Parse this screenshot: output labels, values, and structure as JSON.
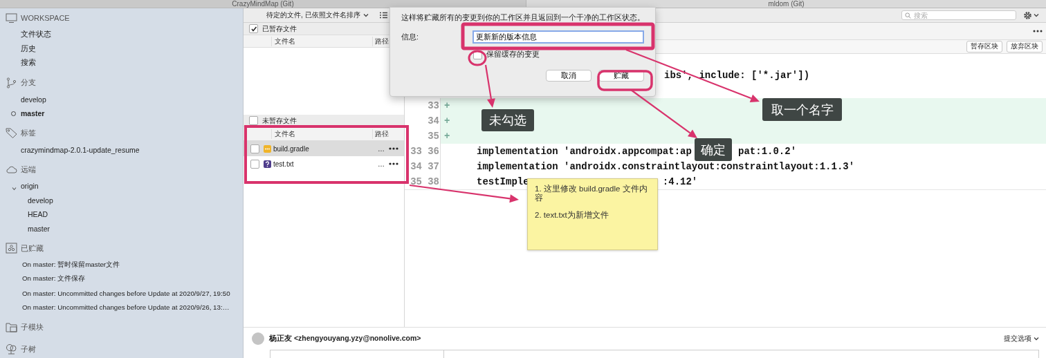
{
  "window_tabs": [
    {
      "title": "CrazyMindMap (Git)",
      "selected": true
    },
    {
      "title": "mldom (Git)",
      "selected": false
    }
  ],
  "sidebar": [
    {
      "kind": "workspace",
      "title": "WORKSPACE",
      "items": [
        {
          "label": "文件状态"
        },
        {
          "label": "历史"
        },
        {
          "label": "搜索"
        }
      ]
    },
    {
      "kind": "branches",
      "title": "分支",
      "items": [
        {
          "label": "develop",
          "current": false
        },
        {
          "label": "master",
          "current": true
        }
      ]
    },
    {
      "kind": "tags",
      "title": "标签",
      "items": [
        {
          "label": "crazymindmap-2.0.1-update_resume"
        }
      ]
    },
    {
      "kind": "remotes",
      "title": "远端",
      "items": [
        {
          "label": "origin",
          "expanded": true,
          "children": [
            {
              "label": "develop"
            },
            {
              "label": "HEAD"
            },
            {
              "label": "master"
            }
          ]
        }
      ]
    },
    {
      "kind": "stashes",
      "title": "已贮藏",
      "items": [
        {
          "label": "On master: 暂时保留master文件"
        },
        {
          "label": "On master: 文件保存"
        },
        {
          "label": "On master: Uncommitted changes before Update at 2020/9/27, 19:50"
        },
        {
          "label": "On master: Uncommitted changes before Update at 2020/9/26, 13:…"
        }
      ]
    },
    {
      "kind": "submodules",
      "title": "子模块"
    },
    {
      "kind": "subtrees",
      "title": "子树"
    }
  ],
  "toolbar": {
    "sort_menu": "待定的文件, 已依照文件名排序",
    "search_placeholder": "搜索"
  },
  "staged": {
    "title": "已暂存文件",
    "checked": true,
    "columns": [
      "文件名",
      "路径"
    ]
  },
  "unstaged": {
    "title": "未暂存文件",
    "checked": false,
    "columns": [
      "文件名",
      "路径"
    ],
    "files": [
      {
        "name": "build.gradle",
        "kind": "modified",
        "path": "…",
        "checked": false,
        "selected": true
      },
      {
        "name": "test.txt",
        "kind": "untracked",
        "path": "…",
        "checked": false,
        "selected": false
      }
    ]
  },
  "diff": {
    "hunk_buttons": [
      "暂存区块",
      "放弃区块"
    ],
    "lines": [
      {
        "kind": "partial",
        "code": "ibs', include: ['*.jar'])"
      },
      {
        "kind": "added",
        "new": "33",
        "marker": "+"
      },
      {
        "kind": "added",
        "new": "34",
        "marker": "+"
      },
      {
        "kind": "added",
        "new": "35",
        "marker": "+"
      },
      {
        "kind": "context",
        "old": "33",
        "new": "36",
        "code": "implementation 'androidx.appcompat:ap",
        "tail": "pat:1.0.2'"
      },
      {
        "kind": "context",
        "old": "34",
        "new": "37",
        "code": "implementation 'androidx.constraintlayout:constraintlayout:1.1.3'"
      },
      {
        "kind": "context",
        "old": "35",
        "new": "38",
        "code": "testImple",
        "tail": ":4.12'"
      }
    ]
  },
  "dialog": {
    "message": "这样将贮藏所有的变更到你的工作区并且返回到一个干净的工作区状态。",
    "field_label": "信息:",
    "field_value": "更新新的版本信息",
    "keep_staged": {
      "label": "保留缓存的变更",
      "checked": false
    },
    "buttons": [
      "取消",
      "贮藏"
    ]
  },
  "commit": {
    "author": "杨正友 <zhengyouyang.yzy@nonolive.com>",
    "options_menu": "提交选项"
  },
  "annotations": {
    "callouts": [
      {
        "text": "未勾选"
      },
      {
        "text": "取一个名字"
      },
      {
        "text": "确定"
      }
    ],
    "note": [
      "1. 这里修改 build.gradle 文件内容",
      "2. text.txt为新增文件"
    ]
  }
}
